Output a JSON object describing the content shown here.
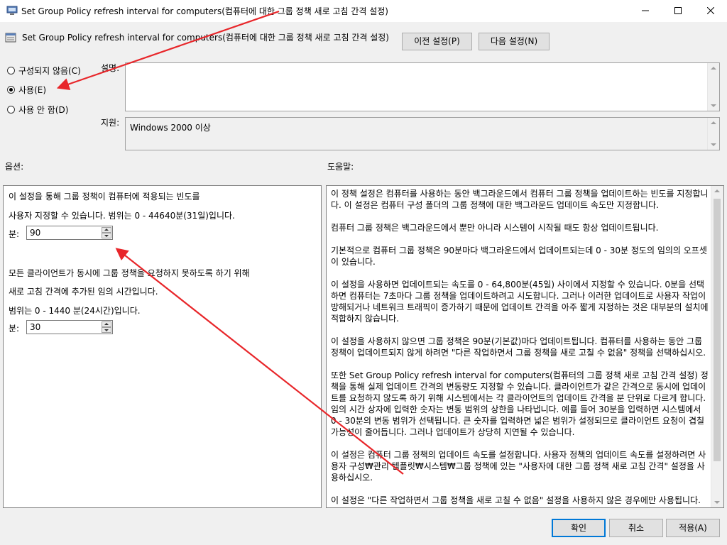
{
  "window": {
    "title": "Set Group Policy refresh interval for computers(컴퓨터에 대한 그룹 정책 새로 고침 간격 설정)"
  },
  "header": {
    "policy_title": "Set Group Policy refresh interval for computers(컴퓨터에 대한 그룹 정책 새로 고침 간격 설정)",
    "prev_button": "이전 설정(P)",
    "next_button": "다음 설정(N)"
  },
  "state": {
    "options": [
      {
        "label": "구성되지 않음(C)",
        "checked": false
      },
      {
        "label": "사용(E)",
        "checked": true
      },
      {
        "label": "사용 안 함(D)",
        "checked": false
      }
    ]
  },
  "comment": {
    "label": "설명:",
    "value": ""
  },
  "supported": {
    "label": "지원:",
    "value": "Windows 2000 이상"
  },
  "options_section": {
    "label": "옵션:",
    "line1": "이 설정을 통해 그룹 정책이 컴퓨터에 적용되는 빈도를",
    "line2": "사용자 지정할 수 있습니다. 범위는 0 - 44640분(31일)입니다.",
    "minutes_label_1": "분:",
    "minutes_value_1": "90",
    "line3": "모든 클라이언트가 동시에 그룹 정책을 요청하지 못하도록 하기 위해",
    "line4": "새로 고침 간격에 추가된 임의 시간입니다.",
    "line5": "범위는 0 - 1440 분(24시간)입니다.",
    "minutes_label_2": "분:",
    "minutes_value_2": "30"
  },
  "help_section": {
    "label": "도움말:",
    "paragraphs": [
      "이 정책 설정은 컴퓨터를 사용하는 동안 백그라운드에서 컴퓨터 그룹 정책을 업데이트하는 빈도를 지정합니다. 이 설정은 컴퓨터 구성 폴더의 그룹 정책에 대한 백그라운드 업데이트 속도만 지정합니다.",
      "컴퓨터 그룹 정책은 백그라운드에서 뿐만 아니라 시스템이 시작될 때도 항상 업데이트됩니다.",
      "기본적으로 컴퓨터 그룹 정책은 90분마다 백그라운드에서 업데이트되는데 0 - 30분 정도의 임의의 오프셋이 있습니다.",
      "이 설정을 사용하면 업데이트되는 속도를 0 - 64,800분(45일) 사이에서 지정할 수 있습니다. 0분을 선택하면 컴퓨터는 7초마다 그룹 정책을 업데이트하려고 시도합니다. 그러나 이러한 업데이트로 사용자 작업이 방해되거나 네트워크 트래픽이 증가하기 때문에 업데이트 간격을 아주 짧게 지정하는 것은 대부분의 설치에 적합하지 않습니다.",
      "이 설정을 사용하지 않으면 그룹 정책은 90분(기본값)마다 업데이트됩니다. 컴퓨터를 사용하는 동안 그룹 정책이 업데이트되지 않게 하려면 \"다른 작업하면서 그룹 정책을 새로 고칠 수 없음\" 정책을 선택하십시오.",
      "또한 Set Group Policy refresh interval for computers(컴퓨터의 그룹 정책 새로 고침 간격 설정) 정책을 통해 실제 업데이트 간격의 변동량도 지정할 수 있습니다. 클라이언트가 같은 간격으로 동시에 업데이트를 요청하지 않도록 하기 위해 시스템에서는 각 클라이언트의 업데이트 간격을 분 단위로 다르게 합니다. 임의 시간 상자에 입력한 숫자는 변동 범위의 상한을 나타냅니다. 예를 들어 30분을 입력하면 시스템에서 0 - 30분의 변동 범위가 선택됩니다. 큰 숫자를 입력하면 넓은 범위가 설정되므로 클라이언트 요청이 겹칠 가능성이 줄어듭니다. 그러나 업데이트가 상당히 지연될 수 있습니다.",
      "이 설정은 컴퓨터 그룹 정책의 업데이트 속도를 설정합니다. 사용자 정책의 업데이트 속도를 설정하려면 사용자 구성₩관리 템플릿₩시스템₩그룹 정책에 있는 \"사용자에 대한 그룹 정책 새로 고침 간격\" 설정을 사용하십시오.",
      "이 설정은 \"다른 작업하면서 그룹 정책을 새로 고칠 수 없음\" 설정을 사용하지 않은 경우에만 사용됩니다."
    ]
  },
  "footer": {
    "ok": "확인",
    "cancel": "취소",
    "apply": "적용(A)"
  },
  "annotation": {
    "color": "#e8262a"
  }
}
